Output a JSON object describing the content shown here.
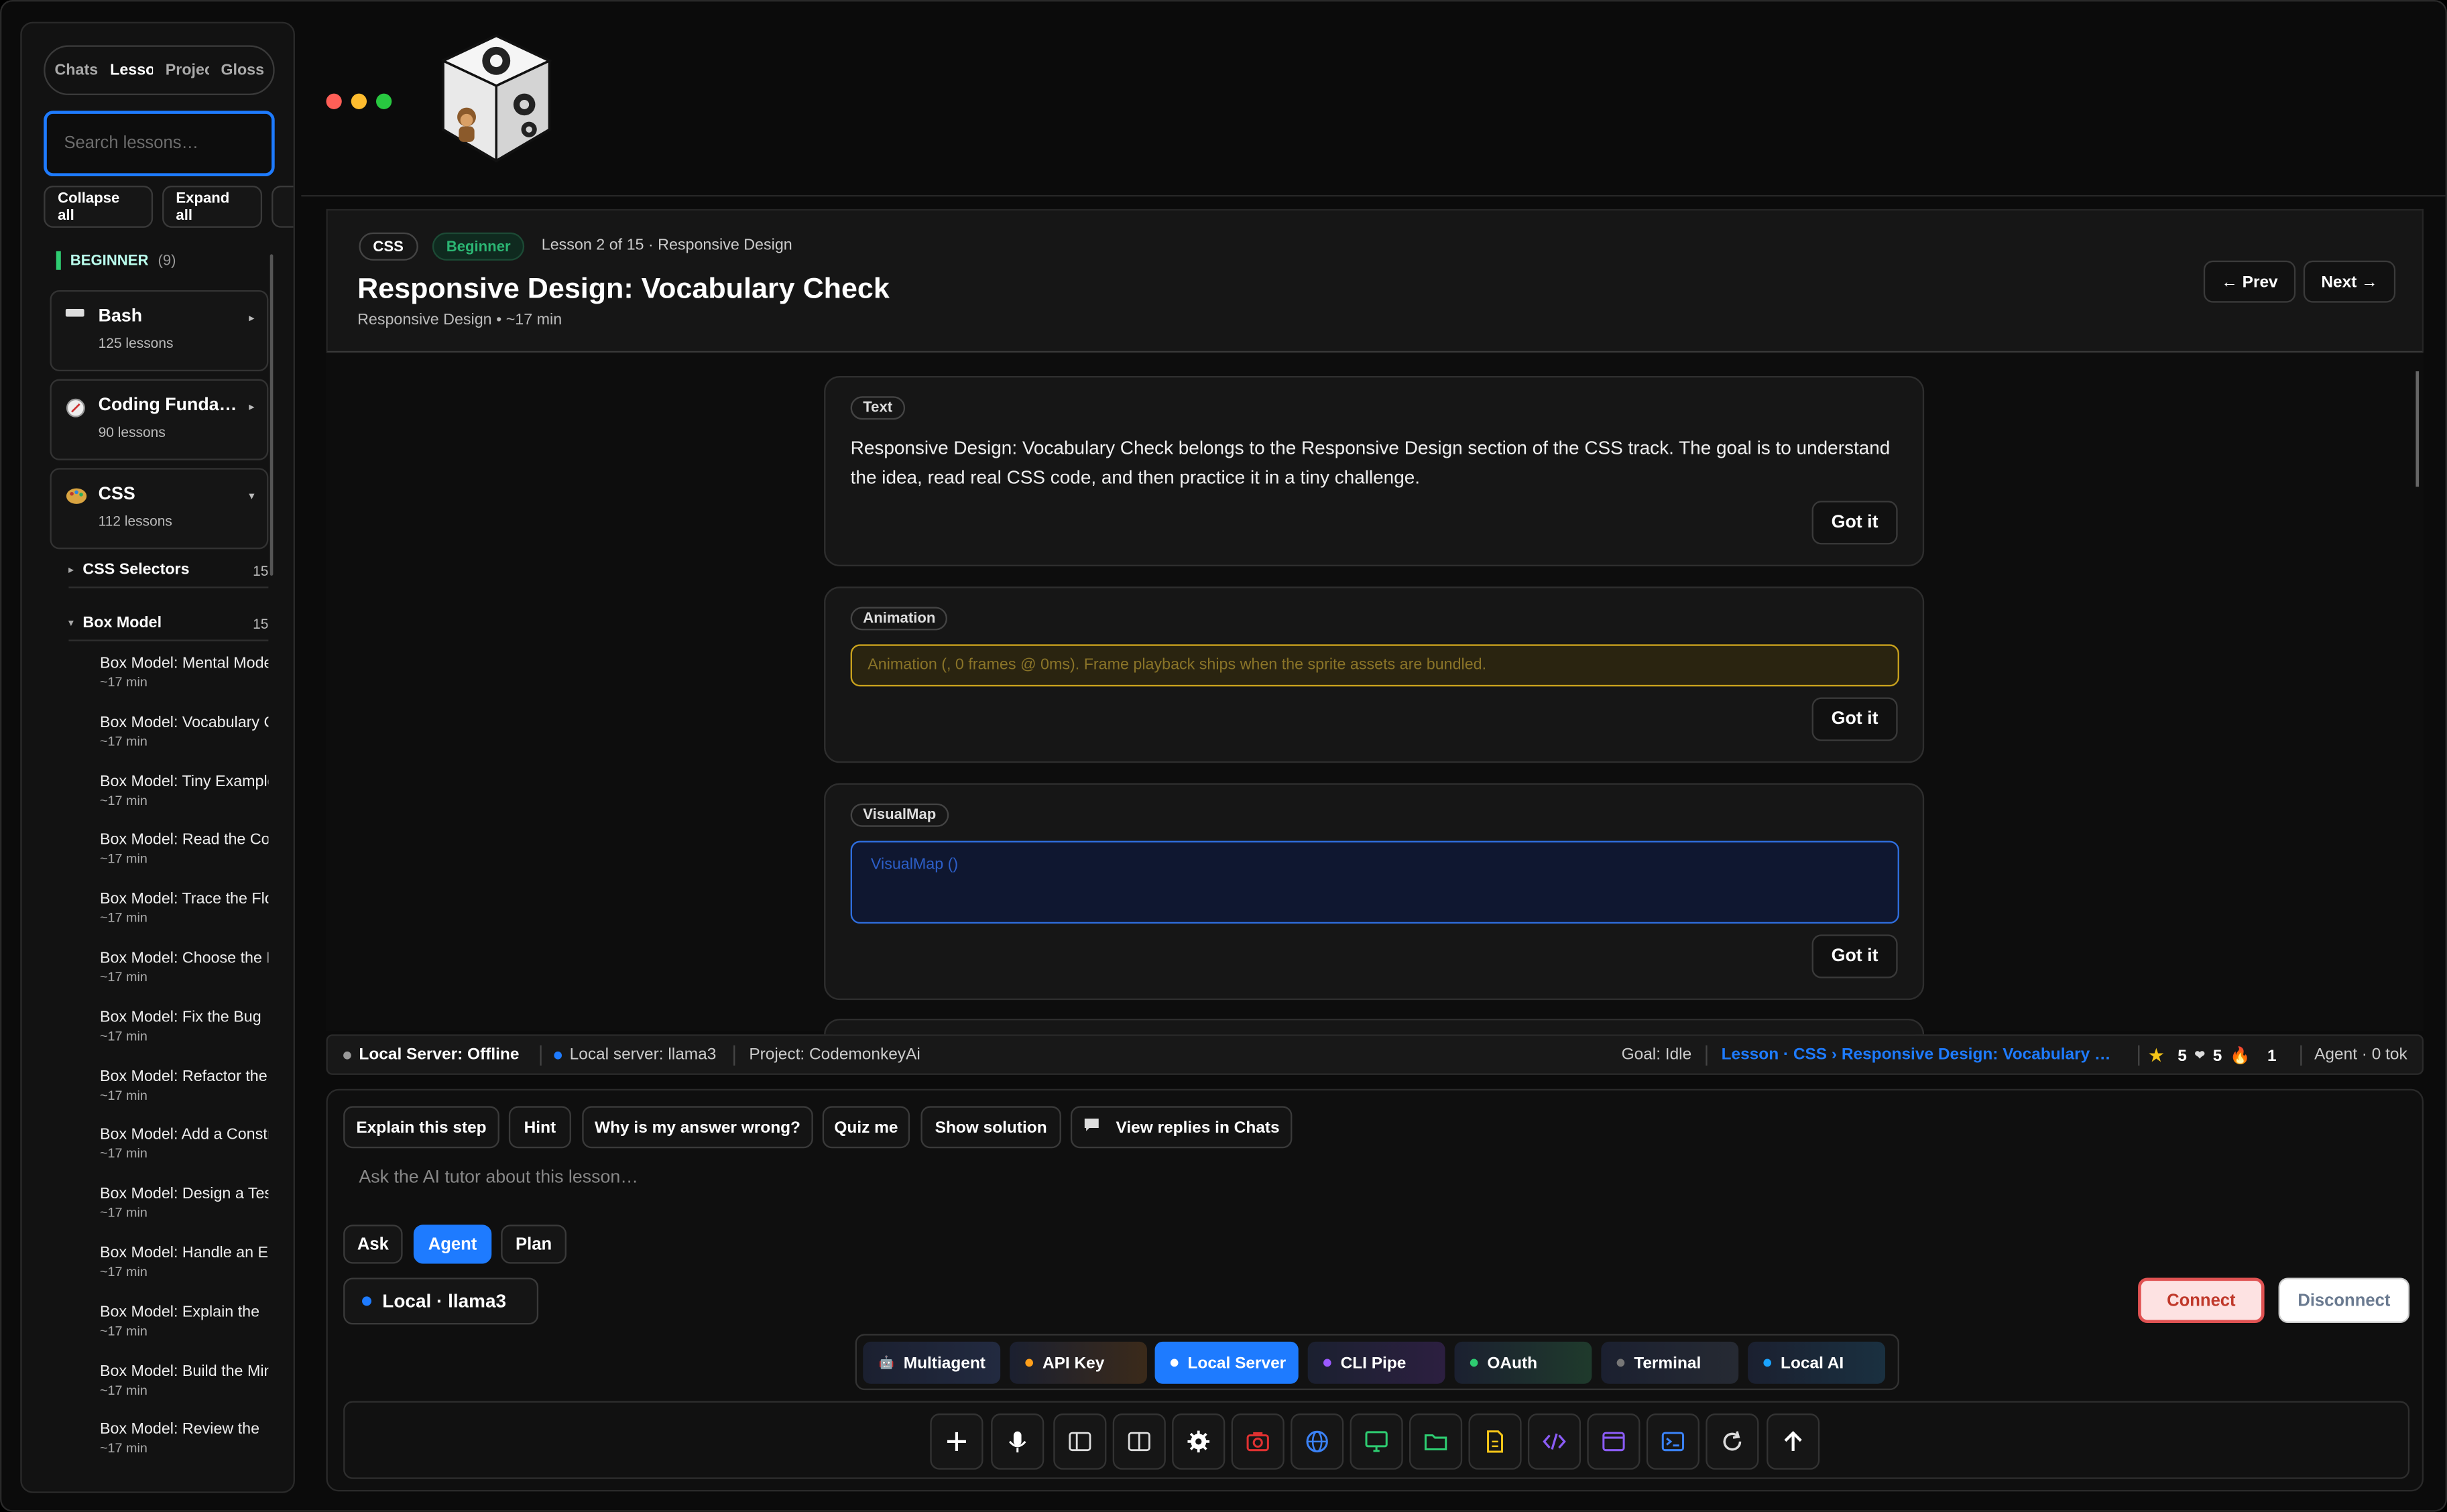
{
  "sidebar": {
    "tabs": [
      "Chats",
      "Lessons",
      "Projects",
      "Glossary"
    ],
    "active_tab": "Lessons",
    "search_placeholder": "Search lessons…",
    "collapse_all": "Collapse all",
    "expand_all": "Expand all",
    "level_label": "BEGINNER",
    "level_count": "(9)",
    "tracks": [
      {
        "name": "Bash",
        "count": "125 lessons",
        "icon": "terminal-icon"
      },
      {
        "name": "Coding Fundamentals",
        "count": "90 lessons",
        "icon": "compass-icon"
      },
      {
        "name": "CSS",
        "count": "112 lessons",
        "icon": "palette-icon"
      }
    ],
    "sections": [
      {
        "name": "CSS Selectors",
        "count": "15"
      },
      {
        "name": "Box Model",
        "count": "15"
      }
    ],
    "lessons": [
      {
        "title": "Box Model: Mental Model",
        "meta": "~17 min"
      },
      {
        "title": "Box Model: Vocabulary Check",
        "meta": "~17 min"
      },
      {
        "title": "Box Model: Tiny Example",
        "meta": "~17 min"
      },
      {
        "title": "Box Model: Read the Code",
        "meta": "~17 min"
      },
      {
        "title": "Box Model: Trace the Flow",
        "meta": "~17 min"
      },
      {
        "title": "Box Model: Choose the Right",
        "meta": "~17 min"
      },
      {
        "title": "Box Model: Fix the Bug",
        "meta": "~17 min"
      },
      {
        "title": "Box Model: Refactor the",
        "meta": "~17 min"
      },
      {
        "title": "Box Model: Add a Constraint",
        "meta": "~17 min"
      },
      {
        "title": "Box Model: Design a Test",
        "meta": "~17 min"
      },
      {
        "title": "Box Model: Handle an Edge",
        "meta": "~17 min"
      },
      {
        "title": "Box Model: Explain the",
        "meta": "~17 min"
      },
      {
        "title": "Box Model: Build the Mini",
        "meta": "~17 min"
      },
      {
        "title": "Box Model: Review the",
        "meta": "~17 min"
      }
    ]
  },
  "lesson": {
    "track_pill": "CSS",
    "level_pill": "Beginner",
    "meta": "Lesson 2 of 15 · Responsive Design",
    "title": "Responsive Design: Vocabulary Check",
    "subtitle": "Responsive Design  •  ~17 min",
    "prev": "← Prev",
    "next": "Next →"
  },
  "cards": {
    "text_tag": "Text",
    "text_body": "Responsive Design: Vocabulary Check belongs to the Responsive Design section of the CSS track. The goal is to understand the idea, read real CSS code, and then practice it in a tiny challenge.",
    "anim_tag": "Animation",
    "anim_body": "Animation (, 0 frames @ 0ms). Frame playback ships when the sprite assets are bundled.",
    "vm_tag": "VisualMap",
    "vm_body": "VisualMap ()",
    "got_it": "Got it"
  },
  "status": {
    "server": "Local Server: Offline",
    "model": "Local server: llama3",
    "project": "Project: CodemonkeyAi",
    "goal": "Goal: Idle",
    "lesson_link": "Lesson · CSS › Responsive Design: Vocabulary …",
    "stars": "5",
    "hearts": "5",
    "streak": "1",
    "agent": "Agent · 0 tok"
  },
  "composer": {
    "quick_actions": [
      "Explain this step",
      "Hint",
      "Why is my answer wrong?",
      "Quiz me",
      "Show solution",
      "View replies in Chats"
    ],
    "prompt_placeholder": "Ask the AI tutor about this lesson…",
    "modes": [
      "Ask",
      "Agent",
      "Plan"
    ],
    "active_mode": "Agent",
    "model": "Local · llama3",
    "connect": "Connect",
    "disconnect": "Disconnect",
    "providers": [
      "Multiagent",
      "API Key",
      "Local Server",
      "CLI Pipe",
      "OAuth",
      "Terminal",
      "Local AI"
    ],
    "active_provider": "Local Server",
    "tools": [
      "plus-icon",
      "mic-icon",
      "sidebar-left-icon",
      "split-view-icon",
      "gear-icon",
      "camera-icon",
      "globe-icon",
      "monitor-icon",
      "folder-icon",
      "file-icon",
      "code-icon",
      "window-icon",
      "terminal-icon",
      "refresh-icon",
      "arrow-up-icon"
    ]
  },
  "colors": {
    "accent": "#1e7bff",
    "success": "#2ecc71",
    "warning": "#c9a21d",
    "danger": "#e05252"
  }
}
